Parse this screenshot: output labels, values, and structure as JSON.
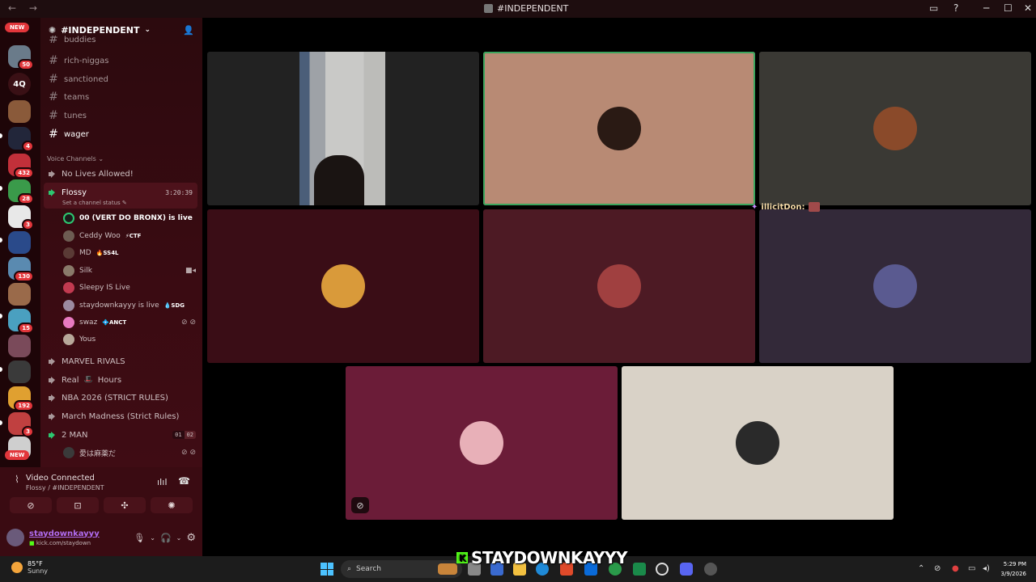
{
  "window": {
    "title": "#INDEPENDENT",
    "nav_glyphs": "← →",
    "controls": [
      "▭",
      "?",
      "─",
      "☐",
      "✕"
    ]
  },
  "servers": {
    "new_top": "NEW",
    "new_bottom": "NEW",
    "fourq": "4Q",
    "badges": [
      "50",
      "4",
      "432",
      "28",
      "3",
      "130",
      "15",
      "192",
      "3"
    ]
  },
  "guild": {
    "name": "#INDEPENDENT",
    "partial_channel": "buddies",
    "text_channels": [
      "rich-niggas",
      "sanctioned",
      "teams",
      "tunes",
      "wager"
    ],
    "voice_category": "Voice Channels",
    "voice_channels": {
      "no_lives": "No Lives Allowed!",
      "flossy": {
        "name": "Flossy",
        "timer": "3:20:39",
        "status_hint": "Set a channel status"
      },
      "users": [
        {
          "name": "00 (VERT DO BRONX) is live",
          "tag": "",
          "color": "#1b1b1b"
        },
        {
          "name": "Ceddy Woo",
          "tag": "⚡CTF",
          "color": "#6d5c52"
        },
        {
          "name": "MD",
          "tag": "🔥SS4L",
          "color": "#5a3a35"
        },
        {
          "name": "Silk",
          "tag": "",
          "color": "#8a7a6a"
        },
        {
          "name": "Sleepy IS Live",
          "tag": "",
          "color": "#c23a50"
        },
        {
          "name": "staydownkayyy is live",
          "tag": "💧SDG",
          "color": "#9c8aa0"
        },
        {
          "name": "swaz",
          "tag": "💠ANCT",
          "color": "#e87ac0"
        },
        {
          "name": "Yous",
          "tag": "",
          "color": "#b8a89a"
        }
      ],
      "others": [
        "MARVEL RIVALS",
        "Real",
        "Hours",
        "NBA 2026 (STRICT RULES)",
        "March Madness (Strict Rules)",
        "2 MAN"
      ],
      "two_man_counts": [
        "01",
        "02"
      ],
      "two_man_user": "愛は麻薬だ"
    }
  },
  "voice_panel": {
    "title": "Video Connected",
    "subtitle": "Flossy / #INDEPENDENT",
    "buttons": [
      "camera-off",
      "screen-share",
      "activities",
      "soundboard"
    ],
    "button_glyphs": [
      "⊘",
      "⊡",
      "✣",
      "✺"
    ]
  },
  "user": {
    "name": "staydownkayyy",
    "status": "kick.com/staydown"
  },
  "stage": {
    "floating_name": "illicitDon:",
    "tiles": [
      {
        "bg": "#222222",
        "type": "video"
      },
      {
        "bg": "#b88a74",
        "avatar": "#2a1a14",
        "speaking": true
      },
      {
        "bg": "#3a3934",
        "avatar": "#8a4a2a"
      },
      {
        "bg": "#3a0d16",
        "avatar": "#d99a3a"
      },
      {
        "bg": "#4d1a24",
        "avatar": "#a04040"
      },
      {
        "bg": "#332939",
        "avatar": "#5a5a90"
      },
      {
        "bg": "#6b1c38",
        "avatar": "#e8b0b8"
      },
      {
        "bg": "#d9d2c7",
        "avatar": "#2a2a2a"
      }
    ]
  },
  "taskbar": {
    "temp": "85°F",
    "weather": "Sunny",
    "search": "Search",
    "time": "5:29 PM",
    "date": "3/9/2026",
    "overlay_name": "STAYDOWNKAYYY"
  }
}
